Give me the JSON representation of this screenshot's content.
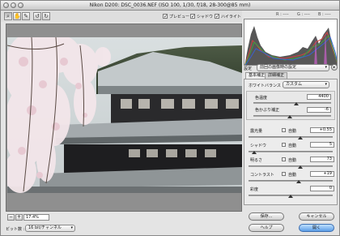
{
  "window": {
    "title": "Nikon D200: DSC_0036.NEF (ISO 100, 1/30, f/18, 28-300@85 mm)"
  },
  "toolbar": {
    "tools": [
      "zoom-icon",
      "hand-icon",
      "eyedropper-icon",
      "rotate-left-icon",
      "rotate-right-icon"
    ],
    "checks": [
      {
        "label": "プレビュー",
        "checked": true
      },
      {
        "label": "シャドウ",
        "checked": true
      },
      {
        "label": "ハイライト",
        "checked": true
      }
    ]
  },
  "histogram": {
    "r": "R : ----",
    "g": "G : ----",
    "b": "B : ----"
  },
  "settings": {
    "label": "設定",
    "value": "前回の画像時の設定"
  },
  "tabs": [
    {
      "label": "基本補正"
    },
    {
      "label": "詳細補正"
    }
  ],
  "white_balance": {
    "label": "ホワイトバランス :",
    "value": "カスタム"
  },
  "adjustments": [
    {
      "label": "色温度",
      "value": "4400",
      "auto": false,
      "level": 0.55
    },
    {
      "label": "色かぶり補正",
      "value": "-6",
      "auto": false,
      "level": 0.47
    },
    {
      "label": "露光量",
      "value": "+0.55",
      "auto": true,
      "level": 0.62
    },
    {
      "label": "シャドウ",
      "value": "5",
      "auto": true,
      "level": 0.07
    },
    {
      "label": "明るさ",
      "value": "73",
      "auto": true,
      "level": 0.62
    },
    {
      "label": "コントラスト",
      "value": "+19",
      "auto": true,
      "level": 0.6
    },
    {
      "label": "彩度",
      "value": "0",
      "auto": false,
      "level": 0.5
    }
  ],
  "auto_label": "自動",
  "zoom": {
    "value": "17.4%"
  },
  "depth": {
    "label": "ビット数 :",
    "value": "16 bit/チャンネル"
  },
  "buttons": {
    "save": "保存...",
    "cancel": "キャンセル",
    "help": "ヘルプ",
    "open": "開く"
  }
}
